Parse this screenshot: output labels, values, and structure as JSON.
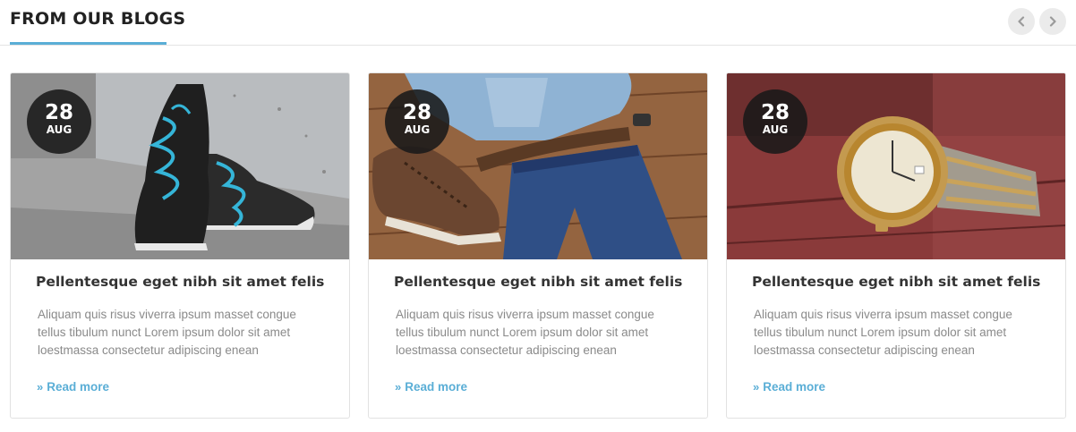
{
  "section": {
    "title": "FROM OUR BLOGS",
    "prev_icon": "chevron-left-icon",
    "next_icon": "chevron-right-icon"
  },
  "colors": {
    "accent": "#5aaed6",
    "badge_bg": "#1e1e1e"
  },
  "posts": [
    {
      "image": "sneakers-photo",
      "date_day": "28",
      "date_month": "AUG",
      "title": "Pellentesque eget nibh sit amet felis",
      "excerpt": "Aliquam quis risus viverra  ipsum masset  congue\ntellus tibulum nunct Lorem ipsum dolor sit amet\nloestmassa consectetur adipiscing  enean",
      "read_more": "Read more",
      "read_more_icon": "double-chevron-right-icon"
    },
    {
      "image": "outfit-flatlay-photo",
      "date_day": "28",
      "date_month": "AUG",
      "title": "Pellentesque eget nibh sit amet felis",
      "excerpt": "Aliquam quis risus viverra  ipsum masset  congue\ntellus tibulum nunct Lorem ipsum dolor sit amet\nloestmassa consectetur adipiscing  enean",
      "read_more": "Read more",
      "read_more_icon": "double-chevron-right-icon"
    },
    {
      "image": "wristwatch-photo",
      "date_day": "28",
      "date_month": "AUG",
      "title": "Pellentesque eget nibh sit amet felis",
      "excerpt": "Aliquam quis risus viverra  ipsum masset  congue\ntellus tibulum nunct Lorem ipsum dolor sit amet\nloestmassa consectetur adipiscing  enean",
      "read_more": "Read more",
      "read_more_icon": "double-chevron-right-icon"
    }
  ]
}
